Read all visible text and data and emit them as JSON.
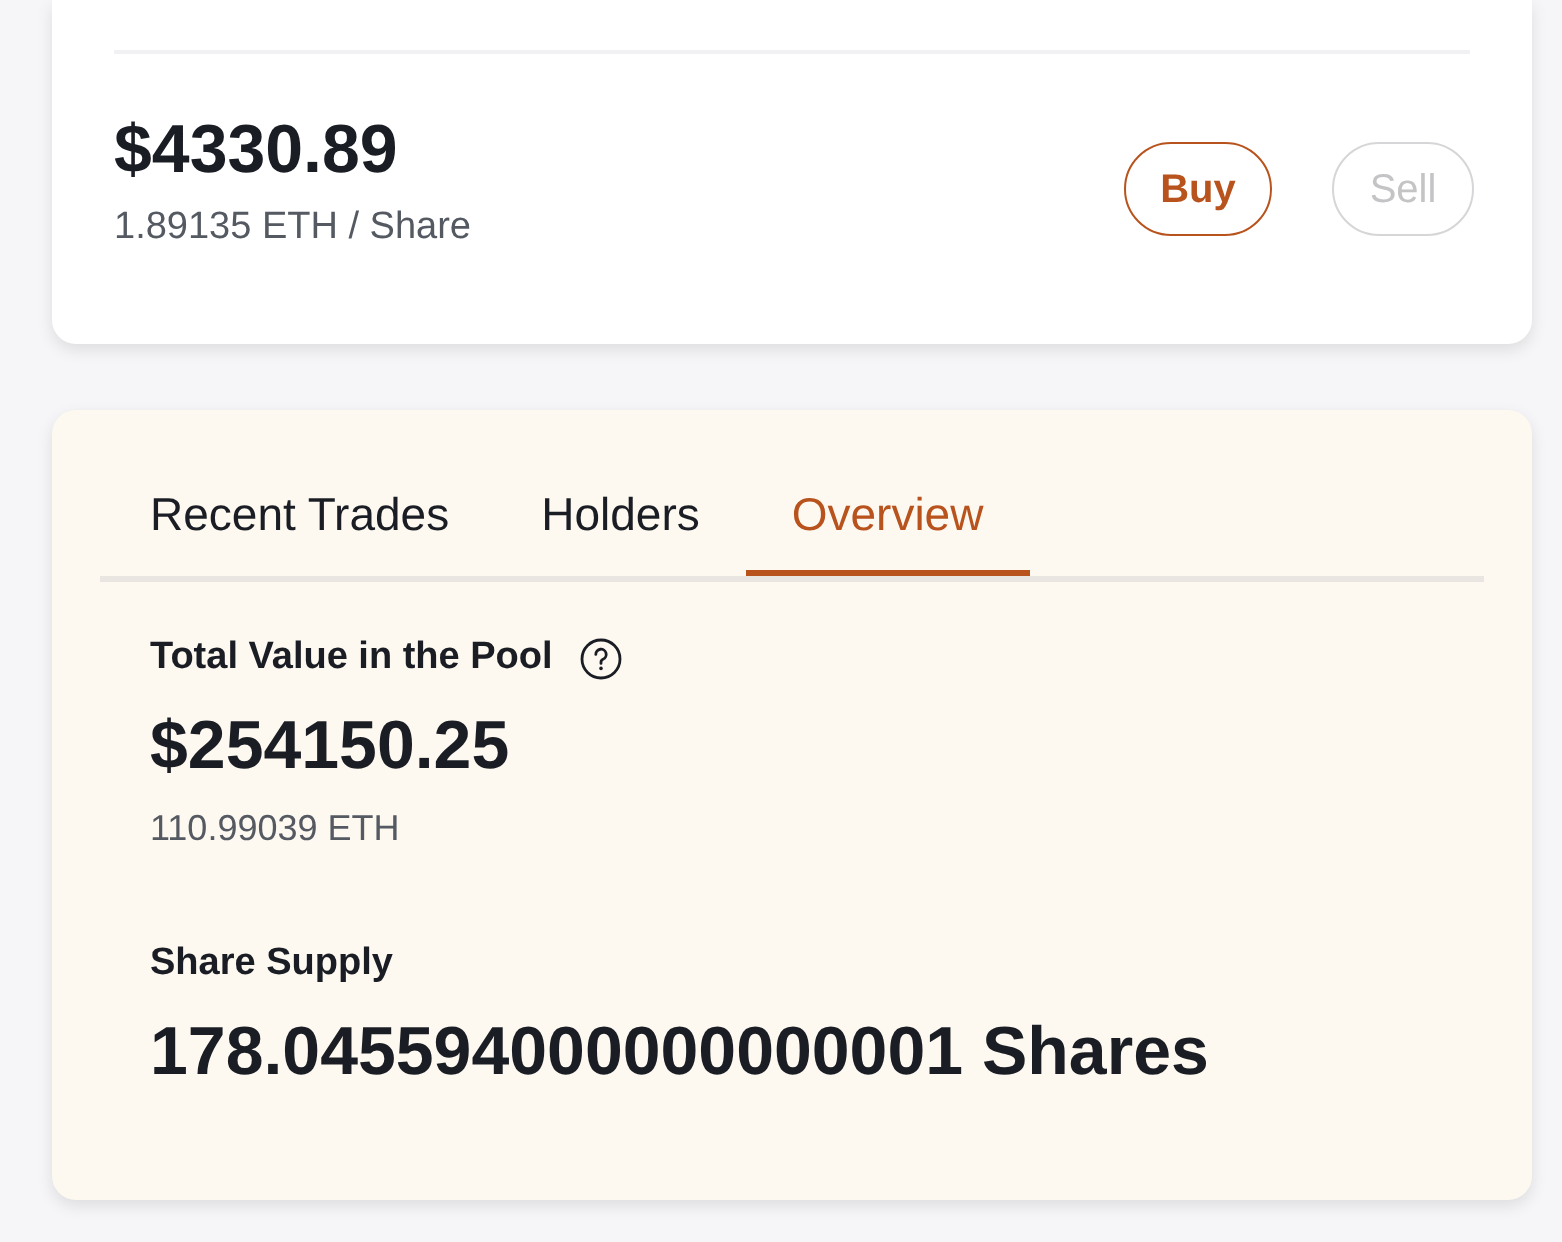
{
  "price": {
    "value": "$4330.89",
    "per_share": "1.89135 ETH / Share"
  },
  "actions": [
    {
      "label": "Buy",
      "disabled": false
    },
    {
      "label": "Sell",
      "disabled": true
    }
  ],
  "tabs": [
    {
      "label": "Recent Trades",
      "selected": false
    },
    {
      "label": "Holders",
      "selected": false
    },
    {
      "label": "Overview",
      "selected": true
    }
  ],
  "stats": [
    {
      "label": "Total Value in the Pool",
      "info": true,
      "value": "$254150.25",
      "secondary": "110.99039 ETH"
    },
    {
      "label": "Share Supply",
      "info": false,
      "value": "178.045594000000000001 Shares"
    }
  ]
}
